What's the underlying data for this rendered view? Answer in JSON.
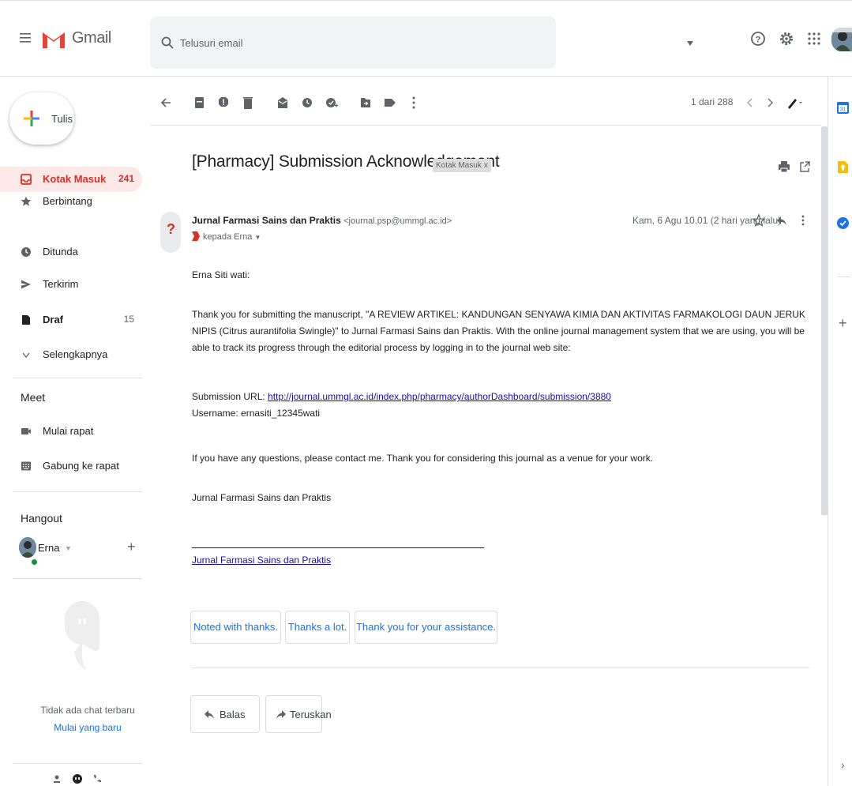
{
  "app": {
    "name": "Gmail"
  },
  "search": {
    "placeholder": "Telusuri email"
  },
  "compose": {
    "label": "Tulis"
  },
  "nav": {
    "items": [
      {
        "label": "Kotak Masuk",
        "count": "241"
      },
      {
        "label": "Berbintang",
        "count": ""
      },
      {
        "label": "Ditunda",
        "count": ""
      },
      {
        "label": "Terkirim",
        "count": ""
      },
      {
        "label": "Draf",
        "count": "15"
      },
      {
        "label": "Selengkapnya",
        "count": ""
      }
    ]
  },
  "meet": {
    "title": "Meet",
    "start": "Mulai rapat",
    "join": "Gabung ke rapat"
  },
  "hangout": {
    "title": "Hangout",
    "user": "Erna",
    "empty": "Tidak ada chat terbaru",
    "start_new": "Mulai yang baru"
  },
  "toolbar": {
    "pagination": "1 dari 288"
  },
  "message": {
    "subject": "[Pharmacy] Submission Acknowledgement",
    "label": "Kotak Masuk",
    "label_close": "x",
    "sender_name": "Jurnal Farmasi Sains dan Praktis",
    "sender_email": "<journal.psp@ummgl.ac.id>",
    "recipient": "kepada Erna",
    "date": "Kam, 6 Agu 10.01 (2 hari yang lalu)",
    "greeting": "Erna Siti wati:",
    "paragraph1": "Thank you for submitting the manuscript, \"A REVIEW ARTIKEL: KANDUNGAN SENYAWA KIMIA DAN AKTIVITAS FARMAKOLOGI DAUN JERUK NIPIS (Citrus aurantifolia Swingle)\" to Jurnal Farmasi Sains dan Praktis. With the online journal management system that we are using, you will be able to track its progress through the editorial process by logging in to the journal web site:",
    "submission_url_label": "Submission URL: ",
    "submission_url": "http://journal.ummgl.ac.id/index.php/pharmacy/authorDashboard/submission/3880",
    "username_line": "Username: ernasiti_12345wati",
    "paragraph2": "If you have any questions, please contact me. Thank you for considering this journal as a venue for your work.",
    "signoff": "Jurnal Farmasi Sains dan Praktis",
    "signature_link": "Jurnal Farmasi Sains dan Praktis"
  },
  "smart_replies": [
    "Noted with thanks.",
    "Thanks a lot.",
    "Thank you for your assistance."
  ],
  "actions": {
    "reply": "Balas",
    "forward": "Teruskan"
  },
  "colors": {
    "accent_red": "#d93025",
    "link_blue": "#1a73e8",
    "inbox_bg": "#fce8e6"
  },
  "icons": [
    "menu-icon",
    "gmail-logo",
    "search-icon",
    "help-icon",
    "gear-icon",
    "apps-icon",
    "back-icon",
    "archive-icon",
    "report-spam-icon",
    "delete-icon",
    "mark-unread-icon",
    "snooze-icon",
    "add-task-icon",
    "move-to-icon",
    "label-icon",
    "more-icon",
    "print-icon",
    "open-new-window-icon",
    "star-icon",
    "reply-icon",
    "calendar-icon",
    "keep-icon",
    "tasks-icon"
  ]
}
